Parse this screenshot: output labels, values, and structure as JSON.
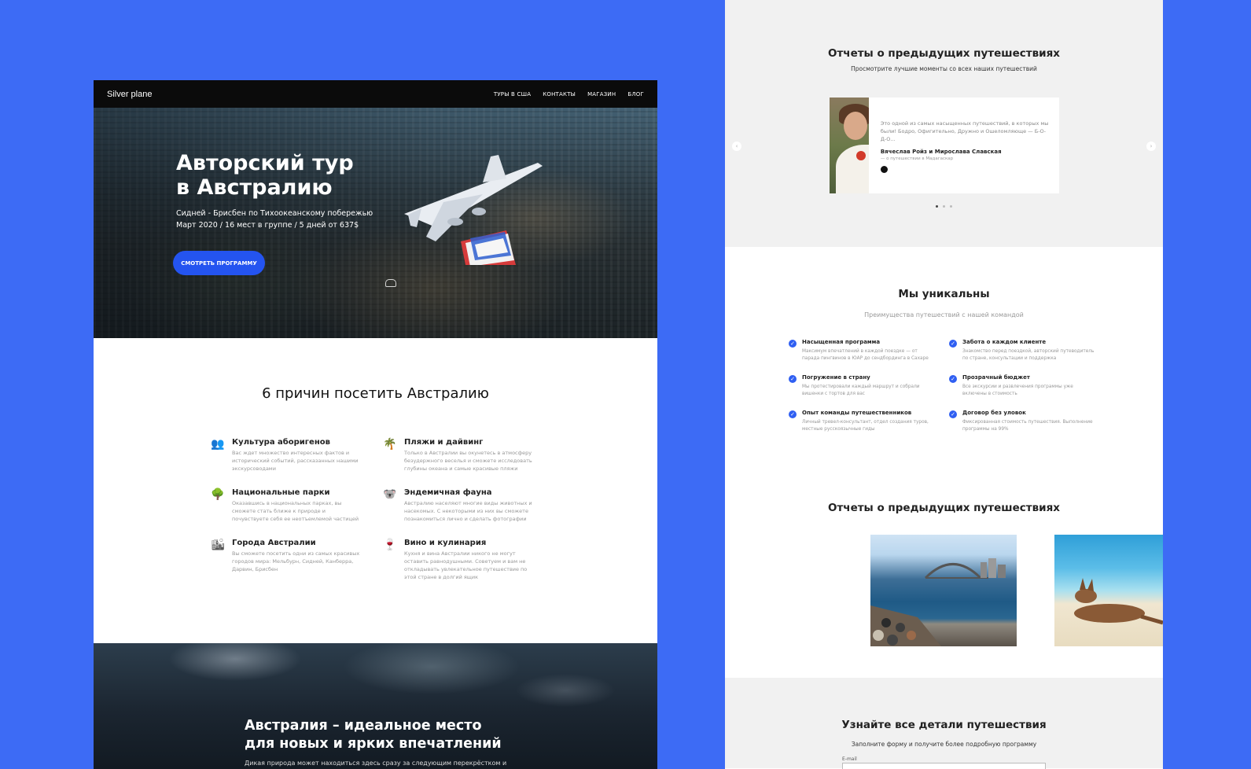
{
  "left_page": {
    "nav": {
      "logo": "Silver plane",
      "items": [
        "ТУРЫ В США",
        "КОНТАКТЫ",
        "МАГАЗИН",
        "БЛОГ"
      ]
    },
    "hero": {
      "title_line1": "Авторский тур",
      "title_line2": "в Австралию",
      "sub_line1": "Сидней - Брисбен по Тихоокеанскому побережью",
      "sub_line2": "Март 2020 / 16 мест в группе / 5 дней от 637$",
      "button": "СМОТРЕТЬ ПРОГРАММУ"
    },
    "reasons": {
      "title": "6 причин посетить Австралию",
      "items": [
        {
          "icon": "people-icon",
          "title": "Культура аборигенов",
          "text": "Вас ждет множество интересных фактов и исторический событий, рассказанных нашими экскурсоводами"
        },
        {
          "icon": "palm-icon",
          "title": "Пляжи и дайвинг",
          "text": "Только в Австралии вы окунетесь в атмосферу безудержного веселья и сможете исследовать глубины океана и самые красивые пляжи"
        },
        {
          "icon": "tree-icon",
          "title": "Национальные парки",
          "text": "Оказавшись в национальных парках, вы сможете стать ближе к природе и почувствуете себя ее неотъемлемой частицей"
        },
        {
          "icon": "koala-icon",
          "title": "Эндемичная фауна",
          "text": "Австралию населяют многие виды животных и насекомых. С некоторыми из них вы сможете познакомиться лично и сделать фотографии"
        },
        {
          "icon": "city-icon",
          "title": "Города Австралии",
          "text": "Вы сможете посетить одни из самых красивых городов мира: Мельбурн, Сидней, Канберра, Дарвин, Брисбен"
        },
        {
          "icon": "wine-icon",
          "title": "Вино и кулинария",
          "text": "Кухня и вина Австралии никого не могут оставить равнодушными. Советуем и вам не откладывать увлекательное путешествие по этой стране в долгий ящик"
        }
      ]
    },
    "ocean": {
      "title_line1": "Австралия – идеальное место",
      "title_line2": "для новых и ярких впечатлений",
      "text": "Дикая природа может находиться здесь сразу за следующим перекрёстком и"
    }
  },
  "right_page": {
    "reports": {
      "title": "Отчеты о предыдущих путешествиях",
      "subtitle": "Просмотрите лучшие моменты со всех наших путешествий",
      "quote": "Это одной из самых насыщенных путешествий, в которых мы были! Бодро, Офигительно, Дружно и Ошеломляюще — Б-О-Д-О...",
      "author": "Вячеслав Ройз и Мирослава Славская",
      "trip": "— о путешествии в Мадагаскар",
      "dots": 3,
      "active_dot": 0
    },
    "unique": {
      "title": "Мы уникальны",
      "subtitle": "Преимущества путешествий с нашей командой",
      "items": [
        {
          "title": "Насыщенная программа",
          "text": "Максимум впечатлений в каждой поездке — от парада пингвинов в ЮАР до сендбординга в Сахаре"
        },
        {
          "title": "Забота о каждом клиенте",
          "text": "Знакомство перед поездкой, авторский путеводитель по стране, консультации и поддержка"
        },
        {
          "title": "Погружение в страну",
          "text": "Мы протестировали каждый маршрут и собрали вишенки с тортов для вас"
        },
        {
          "title": "Прозрачный бюджет",
          "text": "Все экскурсии и развлечения программы уже включены в стоимость"
        },
        {
          "title": "Опыт команды путешественников",
          "text": "Личный тревел-консультант, отдел создания туров, местные русскоязычные гиды"
        },
        {
          "title": "Договор без уловок",
          "text": "Фиксированная стоимость путешествия. Выполнение программы на 99%"
        }
      ]
    },
    "reports2": {
      "title": "Отчеты о предыдущих путешествиях"
    },
    "contact": {
      "title": "Узнайте все детали путешествия",
      "subtitle": "Заполните форму и получите более подробную программу",
      "email_label": "E-mail"
    }
  }
}
